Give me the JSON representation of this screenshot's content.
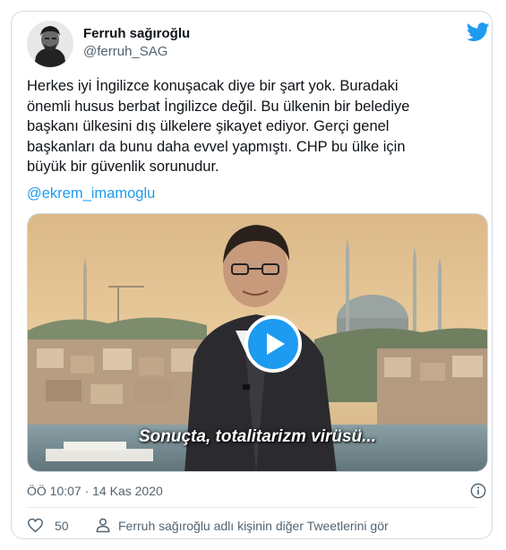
{
  "user": {
    "display_name": "Ferruh sağıroğlu",
    "handle": "@ferruh_SAG",
    "avatar_icon": "profile-avatar",
    "platform_icon": "twitter-bird-icon",
    "brand_color": "#1d9bf0"
  },
  "tweet": {
    "text_lines": [
      "Herkes iyi İngilizce konuşacak diye bir şart yok. Buradaki",
      "önemli husus berbat İngilizce değil. Bu ülkenin bir belediye",
      "başkanı ülkesini dış ülkelere şikayet ediyor. Gerçi genel",
      "başkanları da bunu daha evvel yapmıştı. CHP bu ülke için",
      "büyük bir güvenlik sorunudur."
    ],
    "mention": "@ekrem_imamoglu"
  },
  "media": {
    "subtitle": "Sonuçta, totalitarizm virüsü...",
    "play_icon": "play-icon"
  },
  "footer": {
    "timestamp": "ÖÖ 10:07 · 14 Kas 2020",
    "like_count": "50",
    "more_tweets": "Ferruh sağıroğlu adlı kişinin diğer Tweetlerini gör"
  }
}
